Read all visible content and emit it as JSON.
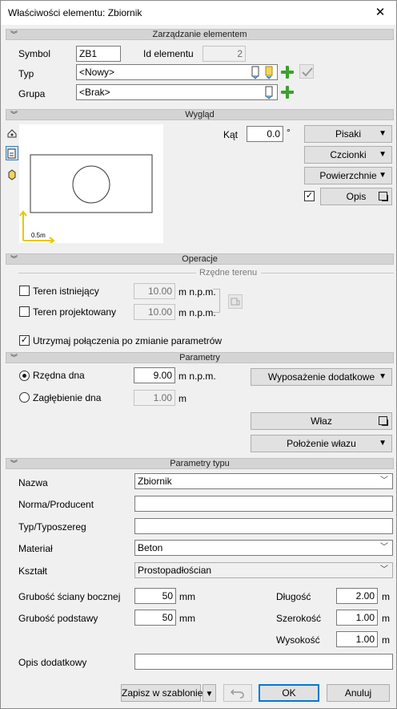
{
  "window": {
    "title": "Właściwości elementu: Zbiornik"
  },
  "sections": {
    "management": "Zarządzanie elementem",
    "appearance": "Wygląd",
    "operations": "Operacje",
    "parameters": "Parametry",
    "type_parameters": "Parametry typu"
  },
  "management": {
    "symbol_label": "Symbol",
    "symbol_value": "ZB1",
    "id_label": "Id elementu",
    "id_value": "2",
    "type_label": "Typ",
    "type_value": "<Nowy>",
    "group_label": "Grupa",
    "group_value": "<Brak>"
  },
  "appearance": {
    "scale_label": "0.5m",
    "angle_label": "Kąt",
    "angle_value": "0.0",
    "angle_unit": "°",
    "pens_button": "Pisaki",
    "fonts_button": "Czcionki",
    "surfaces_button": "Powierzchnie",
    "description_button": "Opis",
    "description_checked": "✓"
  },
  "operations": {
    "terrain_heading": "Rzędne terenu",
    "existing_label": "Teren istniejący",
    "existing_value": "10.00",
    "projected_label": "Teren projektowany",
    "projected_value": "10.00",
    "unit": "m n.p.m.",
    "keep_connections_label": "Utrzymaj połączenia po zmianie parametrów",
    "keep_connections_checked": "✓"
  },
  "parameters": {
    "bottom_ordinate_label": "Rzędna dna",
    "bottom_ordinate_value": "9.00",
    "bottom_ordinate_unit": "m n.p.m.",
    "bottom_depth_label": "Zagłębienie dna",
    "bottom_depth_value": "1.00",
    "bottom_depth_unit": "m",
    "extras_button": "Wyposażenie dodatkowe",
    "hatch_button": "Właz",
    "hatch_position_button": "Położenie włazu"
  },
  "type_params": {
    "name_label": "Nazwa",
    "name_value": "Zbiornik",
    "norm_label": "Norma/Producent",
    "norm_value": "",
    "series_label": "Typ/Typoszereg",
    "series_value": "",
    "material_label": "Materiał",
    "material_value": "Beton",
    "shape_label": "Kształt",
    "shape_value": "Prostopadłościan",
    "wall_label": "Grubość ściany bocznej",
    "wall_value": "50",
    "wall_unit": "mm",
    "base_label": "Grubość podstawy",
    "base_value": "50",
    "base_unit": "mm",
    "length_label": "Długość",
    "length_value": "2.00",
    "length_unit": "m",
    "width_label": "Szerokość",
    "width_value": "1.00",
    "width_unit": "m",
    "height_label": "Wysokość",
    "height_value": "1.00",
    "height_unit": "m",
    "extra_label": "Opis dodatkowy",
    "extra_value": ""
  },
  "footer": {
    "save_template_button": "Zapisz w szablonie",
    "ok_button": "OK",
    "cancel_button": "Anuluj"
  },
  "icons": {
    "close": "close-icon",
    "chevron": "chevron-down-icon",
    "add": "plus-icon",
    "check": "checkmark-icon",
    "edit": "edit-icon",
    "undo": "undo-icon",
    "popup": "popup-icon"
  },
  "colors": {
    "add_green": "#3aa12c",
    "section_bar": "#d4d4d4",
    "axis_yellow": "#e8c800",
    "ok_border": "#0078d7"
  }
}
